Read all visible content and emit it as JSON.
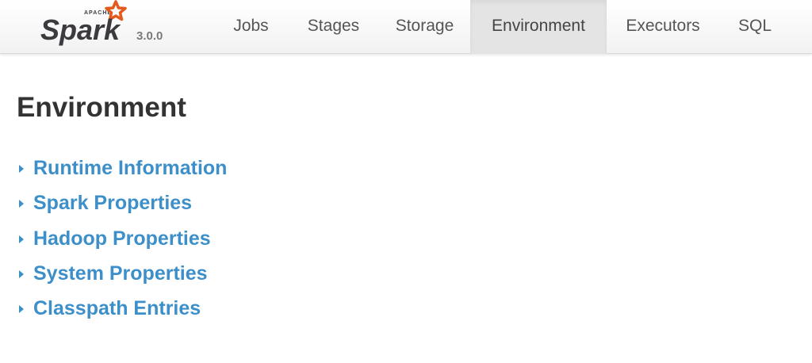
{
  "brand": {
    "small_text": "APACHE",
    "name": "Spark",
    "version": "3.0.0",
    "colors": {
      "star": "#e25a1c",
      "text": "#3c3a3e"
    }
  },
  "nav": {
    "tabs": [
      {
        "label": "Jobs",
        "active": false
      },
      {
        "label": "Stages",
        "active": false
      },
      {
        "label": "Storage",
        "active": false
      },
      {
        "label": "Environment",
        "active": true
      },
      {
        "label": "Executors",
        "active": false
      },
      {
        "label": "SQL",
        "active": false
      }
    ]
  },
  "page": {
    "title": "Environment"
  },
  "sections": [
    {
      "label": "Runtime Information",
      "icon": "caret-right-icon"
    },
    {
      "label": "Spark Properties",
      "icon": "caret-right-icon"
    },
    {
      "label": "Hadoop Properties",
      "icon": "caret-right-icon"
    },
    {
      "label": "System Properties",
      "icon": "caret-right-icon"
    },
    {
      "label": "Classpath Entries",
      "icon": "caret-right-icon"
    }
  ],
  "colors": {
    "link": "#3d8fc9",
    "active_tab_bg": "#e4e4e4",
    "title": "#333333"
  }
}
